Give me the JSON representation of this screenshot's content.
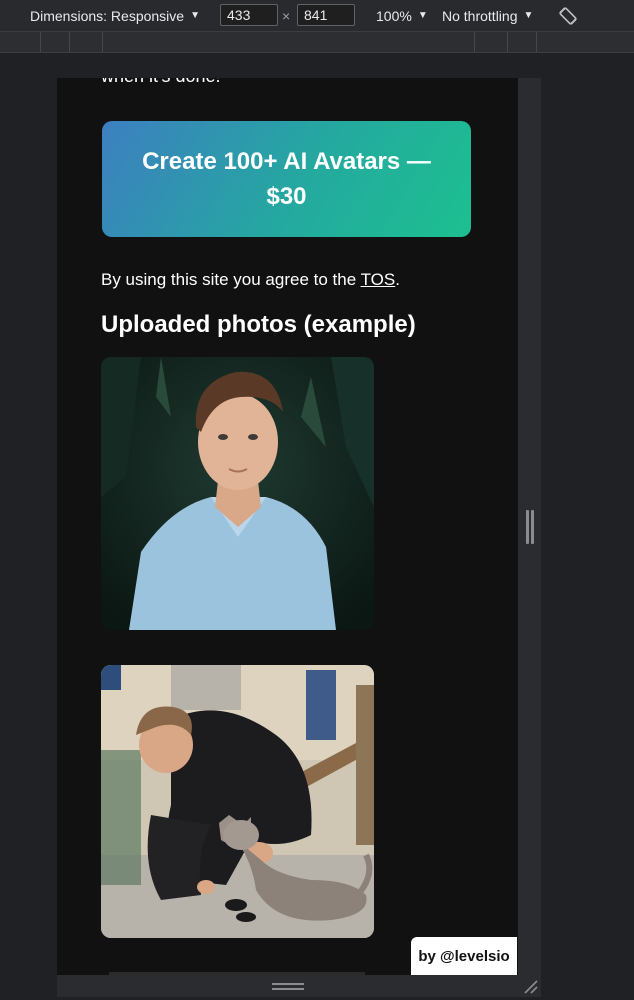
{
  "devtools": {
    "dimensions_label": "Dimensions: Responsive",
    "width_value": "433",
    "times_symbol": "×",
    "height_value": "841",
    "zoom_label": "100%",
    "throttling_label": "No throttling",
    "caret": "▼"
  },
  "page": {
    "intro_text": "when it's done!",
    "cta_label": "Create 100+ AI Avatars — $30",
    "tos_prefix": "By using this site you agree to the ",
    "tos_link": "TOS",
    "tos_suffix": ".",
    "heading": "Uploaded photos (example)"
  },
  "badge": {
    "label": "by @levelsio"
  },
  "colors": {
    "cta_gradient_start": "#3d7fc0",
    "cta_gradient_end": "#1dc08f",
    "page_background": "#111111",
    "devtools_background": "#202124"
  }
}
